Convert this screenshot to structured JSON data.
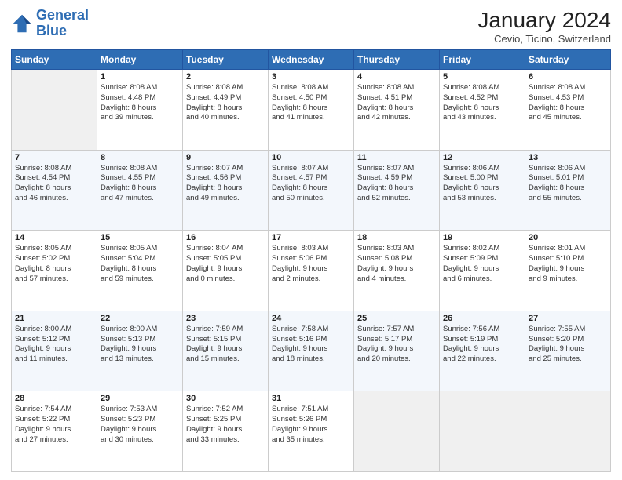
{
  "logo": {
    "line1": "General",
    "line2": "Blue"
  },
  "title": "January 2024",
  "subtitle": "Cevio, Ticino, Switzerland",
  "days_header": [
    "Sunday",
    "Monday",
    "Tuesday",
    "Wednesday",
    "Thursday",
    "Friday",
    "Saturday"
  ],
  "weeks": [
    [
      {
        "num": "",
        "info": ""
      },
      {
        "num": "1",
        "info": "Sunrise: 8:08 AM\nSunset: 4:48 PM\nDaylight: 8 hours\nand 39 minutes."
      },
      {
        "num": "2",
        "info": "Sunrise: 8:08 AM\nSunset: 4:49 PM\nDaylight: 8 hours\nand 40 minutes."
      },
      {
        "num": "3",
        "info": "Sunrise: 8:08 AM\nSunset: 4:50 PM\nDaylight: 8 hours\nand 41 minutes."
      },
      {
        "num": "4",
        "info": "Sunrise: 8:08 AM\nSunset: 4:51 PM\nDaylight: 8 hours\nand 42 minutes."
      },
      {
        "num": "5",
        "info": "Sunrise: 8:08 AM\nSunset: 4:52 PM\nDaylight: 8 hours\nand 43 minutes."
      },
      {
        "num": "6",
        "info": "Sunrise: 8:08 AM\nSunset: 4:53 PM\nDaylight: 8 hours\nand 45 minutes."
      }
    ],
    [
      {
        "num": "7",
        "info": "Sunrise: 8:08 AM\nSunset: 4:54 PM\nDaylight: 8 hours\nand 46 minutes."
      },
      {
        "num": "8",
        "info": "Sunrise: 8:08 AM\nSunset: 4:55 PM\nDaylight: 8 hours\nand 47 minutes."
      },
      {
        "num": "9",
        "info": "Sunrise: 8:07 AM\nSunset: 4:56 PM\nDaylight: 8 hours\nand 49 minutes."
      },
      {
        "num": "10",
        "info": "Sunrise: 8:07 AM\nSunset: 4:57 PM\nDaylight: 8 hours\nand 50 minutes."
      },
      {
        "num": "11",
        "info": "Sunrise: 8:07 AM\nSunset: 4:59 PM\nDaylight: 8 hours\nand 52 minutes."
      },
      {
        "num": "12",
        "info": "Sunrise: 8:06 AM\nSunset: 5:00 PM\nDaylight: 8 hours\nand 53 minutes."
      },
      {
        "num": "13",
        "info": "Sunrise: 8:06 AM\nSunset: 5:01 PM\nDaylight: 8 hours\nand 55 minutes."
      }
    ],
    [
      {
        "num": "14",
        "info": "Sunrise: 8:05 AM\nSunset: 5:02 PM\nDaylight: 8 hours\nand 57 minutes."
      },
      {
        "num": "15",
        "info": "Sunrise: 8:05 AM\nSunset: 5:04 PM\nDaylight: 8 hours\nand 59 minutes."
      },
      {
        "num": "16",
        "info": "Sunrise: 8:04 AM\nSunset: 5:05 PM\nDaylight: 9 hours\nand 0 minutes."
      },
      {
        "num": "17",
        "info": "Sunrise: 8:03 AM\nSunset: 5:06 PM\nDaylight: 9 hours\nand 2 minutes."
      },
      {
        "num": "18",
        "info": "Sunrise: 8:03 AM\nSunset: 5:08 PM\nDaylight: 9 hours\nand 4 minutes."
      },
      {
        "num": "19",
        "info": "Sunrise: 8:02 AM\nSunset: 5:09 PM\nDaylight: 9 hours\nand 6 minutes."
      },
      {
        "num": "20",
        "info": "Sunrise: 8:01 AM\nSunset: 5:10 PM\nDaylight: 9 hours\nand 9 minutes."
      }
    ],
    [
      {
        "num": "21",
        "info": "Sunrise: 8:00 AM\nSunset: 5:12 PM\nDaylight: 9 hours\nand 11 minutes."
      },
      {
        "num": "22",
        "info": "Sunrise: 8:00 AM\nSunset: 5:13 PM\nDaylight: 9 hours\nand 13 minutes."
      },
      {
        "num": "23",
        "info": "Sunrise: 7:59 AM\nSunset: 5:15 PM\nDaylight: 9 hours\nand 15 minutes."
      },
      {
        "num": "24",
        "info": "Sunrise: 7:58 AM\nSunset: 5:16 PM\nDaylight: 9 hours\nand 18 minutes."
      },
      {
        "num": "25",
        "info": "Sunrise: 7:57 AM\nSunset: 5:17 PM\nDaylight: 9 hours\nand 20 minutes."
      },
      {
        "num": "26",
        "info": "Sunrise: 7:56 AM\nSunset: 5:19 PM\nDaylight: 9 hours\nand 22 minutes."
      },
      {
        "num": "27",
        "info": "Sunrise: 7:55 AM\nSunset: 5:20 PM\nDaylight: 9 hours\nand 25 minutes."
      }
    ],
    [
      {
        "num": "28",
        "info": "Sunrise: 7:54 AM\nSunset: 5:22 PM\nDaylight: 9 hours\nand 27 minutes."
      },
      {
        "num": "29",
        "info": "Sunrise: 7:53 AM\nSunset: 5:23 PM\nDaylight: 9 hours\nand 30 minutes."
      },
      {
        "num": "30",
        "info": "Sunrise: 7:52 AM\nSunset: 5:25 PM\nDaylight: 9 hours\nand 33 minutes."
      },
      {
        "num": "31",
        "info": "Sunrise: 7:51 AM\nSunset: 5:26 PM\nDaylight: 9 hours\nand 35 minutes."
      },
      {
        "num": "",
        "info": ""
      },
      {
        "num": "",
        "info": ""
      },
      {
        "num": "",
        "info": ""
      }
    ]
  ]
}
